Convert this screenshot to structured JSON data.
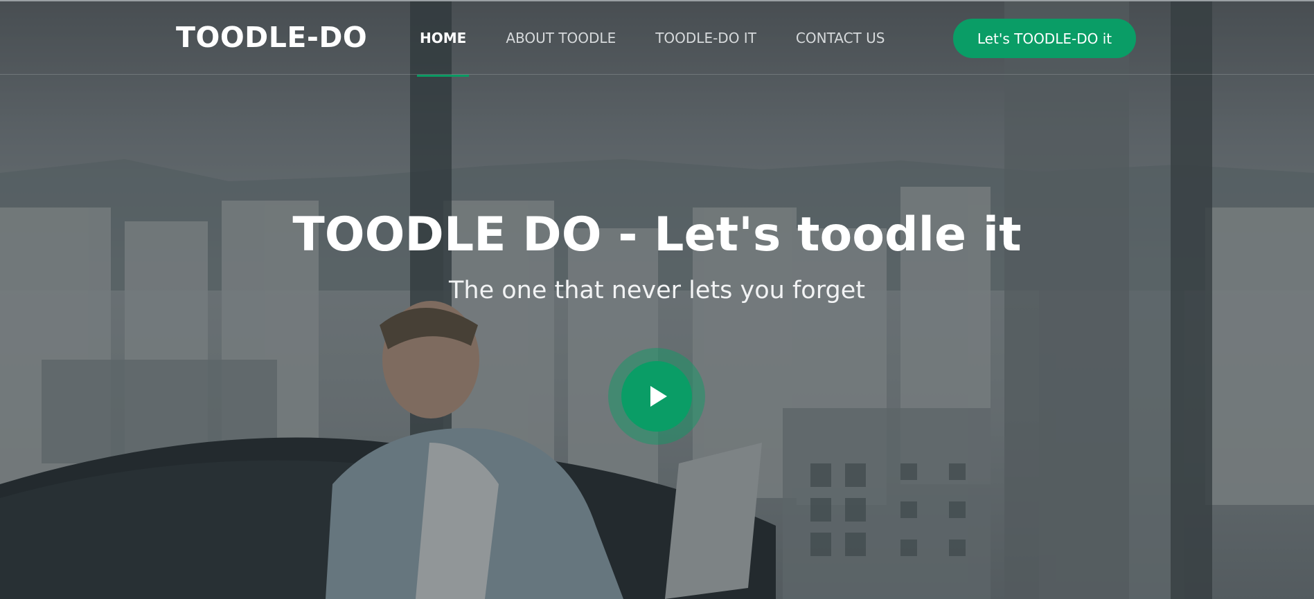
{
  "navbar": {
    "brand": "TOODLE-DO",
    "items": [
      {
        "label": "HOME",
        "active": true
      },
      {
        "label": "ABOUT TOODLE",
        "active": false
      },
      {
        "label": "TOODLE-DO IT",
        "active": false
      },
      {
        "label": "CONTACT US",
        "active": false
      }
    ],
    "cta_label": "Let's TOODLE-DO it"
  },
  "hero": {
    "headline": "TOODLE DO - Let's toodle it",
    "subheadline": "The one that never lets you forget",
    "play_icon": "play-icon"
  },
  "colors": {
    "accent": "#0a9d66",
    "text": "#ffffff"
  }
}
